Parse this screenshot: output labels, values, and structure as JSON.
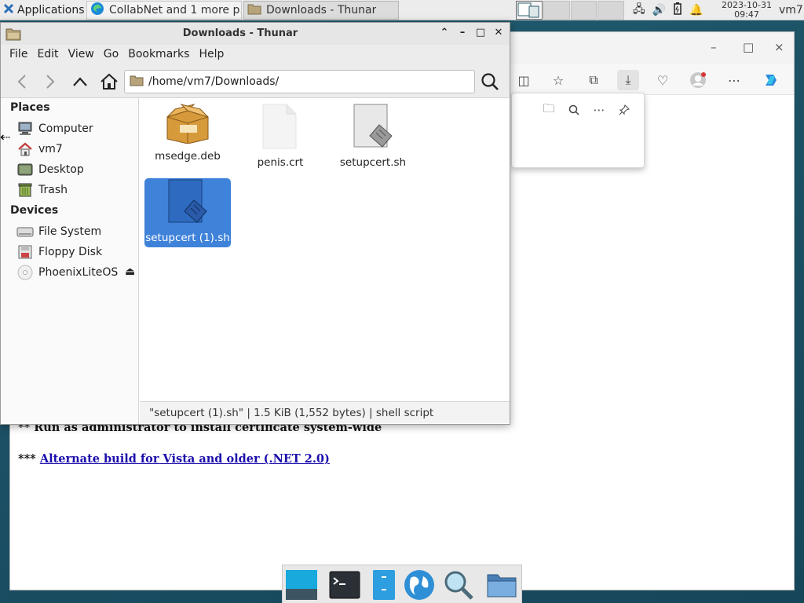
{
  "top_panel": {
    "applications_label": "Applications",
    "tasks": [
      {
        "label": "CollabNet and 1 more p...",
        "icon": "edge-browser-icon"
      },
      {
        "label": "Downloads - Thunar",
        "icon": "folder-icon"
      }
    ],
    "clock": {
      "date": "2023-10-31",
      "time": "09:47"
    },
    "user": "vm7"
  },
  "browser": {
    "window_controls": {
      "minimize": "–",
      "maximize": "□",
      "close": "×"
    },
    "page_lines": {
      "line1": "** Run as administrator to install certificate system-wide",
      "line2_prefix": "***",
      "line2_link": "Alternate build for Vista and older (.NET 2.0)"
    }
  },
  "thunar": {
    "title": "Downloads - Thunar",
    "menu": [
      "File",
      "Edit",
      "View",
      "Go",
      "Bookmarks",
      "Help"
    ],
    "path": "/home/vm7/Downloads/",
    "sidebar": {
      "places_header": "Places",
      "places": [
        "Computer",
        "vm7",
        "Desktop",
        "Trash"
      ],
      "devices_header": "Devices",
      "devices": [
        "File System",
        "Floppy Disk",
        "PhoenixLiteOS"
      ]
    },
    "files": [
      {
        "name": "msedge.deb",
        "type": "package",
        "selected": false
      },
      {
        "name": "penis.crt",
        "type": "blank",
        "selected": false
      },
      {
        "name": "setupcert.sh",
        "type": "script",
        "selected": false
      },
      {
        "name": "setupcert (1).sh",
        "type": "script",
        "selected": true
      }
    ],
    "status": "\"setupcert (1).sh\"  |  1.5 KiB (1,552 bytes)  |  shell script"
  },
  "colors": {
    "selection": "#3f82d9",
    "desktop": "#1d5266"
  }
}
